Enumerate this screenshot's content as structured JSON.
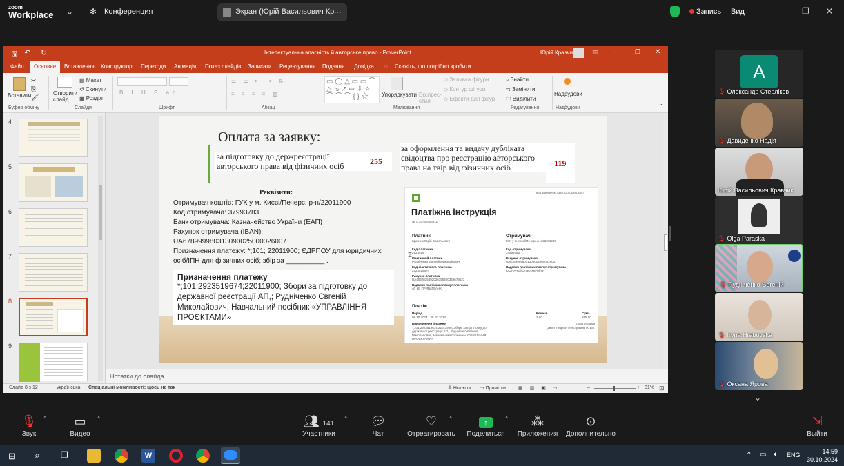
{
  "zoom": {
    "logo_line1": "zoom",
    "logo_line2": "Workplace",
    "conference_label": "Конференция",
    "screen_share_label": "Экран (Юрій Васильович Крав",
    "recording_label": "Запись",
    "view_label": "Вид"
  },
  "ppt": {
    "window_title": "Інтелектуальна власність й авторське право  -  PowerPoint",
    "user": "Юрій Кравчик",
    "tabs": [
      "Файл",
      "Основне",
      "Вставлення",
      "Конструктор",
      "Переходи",
      "Анімація",
      "Показ слайдів",
      "Записати",
      "Рецензування",
      "Подання",
      "Довідка"
    ],
    "tell_me": "Скажіть, що потрібно зробити",
    "ribbon": {
      "paste": "Вставити",
      "clipboard_group": "Буфер обміну",
      "new_slide": "Створити слайд",
      "layout": "Макет",
      "reset": "Скинути",
      "section": "Розділ",
      "slides_group": "Слайди",
      "font_group": "Шрифт",
      "paragraph_group": "Абзац",
      "arrange": "Упорядкувати",
      "quick_styles": "Експрес-стилі",
      "shape_fill": "Заливка фігури",
      "shape_outline": "Контур фігури",
      "shape_effects": "Ефекти для фігур",
      "drawing_group": "Малювання",
      "find": "Знайти",
      "replace": "Замінити",
      "select": "Виділити",
      "editing_group": "Редагування",
      "addins": "Надбудови",
      "addins_group": "Надбудови"
    },
    "thumbs": [
      "4",
      "5",
      "6",
      "7",
      "8",
      "9"
    ],
    "notes_placeholder": "Нотатки до слайда",
    "status": {
      "slide_of": "Слайд 8 з 12",
      "language": "українська",
      "accessibility": "Спеціальні можливості: щось не так",
      "notes": "Нотатки",
      "comments": "Примітки",
      "zoom": "81%"
    }
  },
  "slide": {
    "title": "Оплата за заявку:",
    "fee1_text": "за підготовку до держреєстрації авторського права від фізичних осіб",
    "fee1_amount": "255",
    "fee2_text": "за оформлення та видачу дубліката свідоцтва про реєстрацію авторського права на твір від фізичних осіб",
    "fee2_amount": "119",
    "requisites_heading": "Реквізити:",
    "requisites": [
      "Отримувач коштів: ГУК у м. Києві/Печерс. р-н/22011900",
      "Код отримувача: 37993783",
      "Банк отримувача: Казначейство України (ЕАП)",
      "Рахунок отримувача (IBAN):",
      "UA678999980313090025000026007",
      "Призначення платежу: *;101; 22011900; ЄДРПОУ для юридичних",
      "осіб/ІПН для фізичних осіб; збір за __________ ."
    ],
    "purpose_heading": "Призначення платежу",
    "purpose_text": "*;101;2923519674;22011900; Збори за підготовку до державної реєстрації АП,; Рудніченко Євгеній Миколайович, Навчальний посібник «УПРАВЛІННЯ ПРОЄКТАМИ»",
    "instruction": {
      "title": "Платіжна інструкція",
      "doc_code": "Код документа: 4359-0203-4898-4307",
      "number": "№ 0.39752908911",
      "payer_label": "Платник",
      "payer_name": "Кравчик Юрій Васильович",
      "payer_code_label": "Код платника",
      "payer_code": "2923519",
      "actual_payer_label": "Фактичний платник",
      "actual_payer": "Рудніченко Євгеній Миколайович",
      "actual_code_label": "Код фактичного платника",
      "actual_code": "2923519674",
      "payer_account_label": "Рахунок платника",
      "payer_account": "UA4032835492026355400349678523",
      "payer_bank_label": "Надавач платіжних послуг платника",
      "payer_bank": "АТ КБ ПРИВАТБАНК",
      "receiver_label": "Отримувач",
      "receiver_name": "ГУК у м.Києві/Печерс.р-н/22011900",
      "receiver_code_label": "Код отримувача",
      "receiver_code": "37993783",
      "receiver_account_label": "Рахунок отримувача",
      "receiver_account": "UA678999980313090025000026007",
      "receiver_bank_label": "Надавач платіжних послуг отримувача",
      "receiver_bank": "КАЗНАЧЕЙСТВО УКРАЇНИ",
      "payment_label": "Платіж",
      "period_label": "Період",
      "period": "08.10.2024 - 28.10.2024",
      "commission_label": "Комісія",
      "commission": "3.00",
      "sum_label": "Сума",
      "sum": "255.00",
      "purpose_label": "Призначення платежу",
      "purpose": "*;101;2923519674;22011900; Збори за підготовку до державної реєстрації АП,; Рудніченко Євгеній Миколайович, Навчальний посібник «УПРАВЛІННЯ ПРОЄКТАМИ»",
      "sum_words_label": "Сума словами",
      "sum_words": "Двісті п'ятдесят п'ять гривень 00 коп."
    }
  },
  "participants": [
    {
      "initial": "A",
      "name": "Олександр Стерліков",
      "muted": true
    },
    {
      "name": "Давиденко Надія",
      "muted": true
    },
    {
      "name": "Юрій Васильович Кравчик",
      "muted": false
    },
    {
      "name": "Olga Paraska",
      "muted": true
    },
    {
      "name": "Рудніченко Євгеній",
      "muted": true
    },
    {
      "name": "Iryna  Hrabovska",
      "muted": true
    },
    {
      "name": "Оксана Ярова",
      "muted": true
    }
  ],
  "toolbar": {
    "audio": "Звук",
    "video": "Видео",
    "participants_count": "141",
    "participants": "Участники",
    "chat": "Чат",
    "react": "Отреагировать",
    "share": "Поделиться",
    "apps": "Приложения",
    "more": "Дополнительно",
    "leave": "Выйти"
  },
  "taskbar": {
    "lang": "ENG",
    "time": "14:59",
    "date": "30.10.2024"
  },
  "colors": {
    "ppt_accent": "#c43e1c",
    "record_red": "#e53935",
    "share_green": "#1db954",
    "speaker_border": "#6ed06e"
  }
}
